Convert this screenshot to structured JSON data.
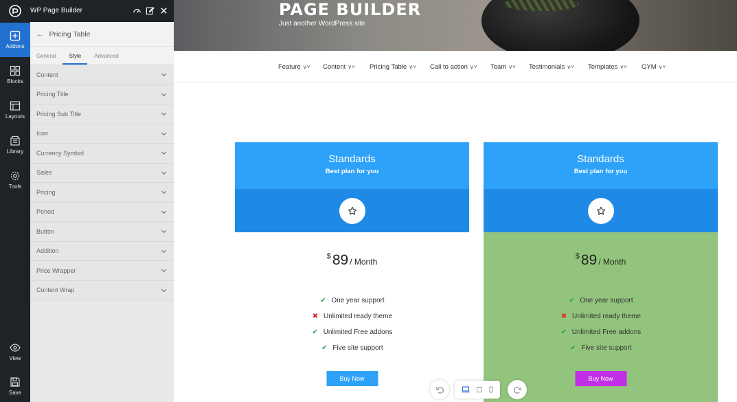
{
  "app": {
    "title": "WP Page Builder"
  },
  "rail": {
    "items": [
      {
        "label": "Addons",
        "icon": "plus-square-icon",
        "active": true
      },
      {
        "label": "Blocks",
        "icon": "blocks-icon"
      },
      {
        "label": "Layouts",
        "icon": "layouts-icon"
      },
      {
        "label": "Library",
        "icon": "library-icon"
      },
      {
        "label": "Tools",
        "icon": "gear-icon"
      }
    ],
    "bottom": [
      {
        "label": "View",
        "icon": "eye-icon"
      },
      {
        "label": "Save",
        "icon": "save-icon"
      }
    ]
  },
  "panel": {
    "heading": "Pricing Table",
    "tabs": [
      "General",
      "Style",
      "Advanced"
    ],
    "active_tab": "Style",
    "sections": [
      "Content",
      "Pricing Title",
      "Pricing Sub Title",
      "Icon",
      "Currency Symbol",
      "Sales",
      "Pricing",
      "Period",
      "Button",
      "Addition",
      "Price Wrapper",
      "Content Wrap"
    ]
  },
  "site": {
    "title": "PAGE BUILDER",
    "tagline": "Just another WordPress site"
  },
  "nav": [
    "Feature",
    "Content",
    "Pricing Table",
    "Call to action",
    "Team",
    "Testimonials",
    "Templates",
    "GYM"
  ],
  "cards": [
    {
      "name": "Standards",
      "subtitle": "Best plan for you",
      "currency": "$",
      "amount": "89",
      "period": "/ Month",
      "features": [
        {
          "text": "One year support",
          "included": true
        },
        {
          "text": "Unlimited ready theme",
          "included": false
        },
        {
          "text": "Unlimited Free addons",
          "included": true
        },
        {
          "text": "Five site support",
          "included": true
        }
      ],
      "button": "Buy Now",
      "body_color": "#ffffff",
      "button_color": "#2ea2f8"
    },
    {
      "name": "Standards",
      "subtitle": "Best plan for you",
      "currency": "$",
      "amount": "89",
      "period": "/ Month",
      "features": [
        {
          "text": "One year support",
          "included": true
        },
        {
          "text": "Unlimited ready theme",
          "included": false
        },
        {
          "text": "Unlimited Free addons",
          "included": true
        },
        {
          "text": "Five site support",
          "included": true
        }
      ],
      "button": "Buy Now",
      "body_color": "#93c47d",
      "button_color": "#c12fe6"
    }
  ],
  "colors": {
    "accent": "#2271d1",
    "card_header": "#2ea2f8",
    "card_iconband": "#1f8ae6"
  }
}
